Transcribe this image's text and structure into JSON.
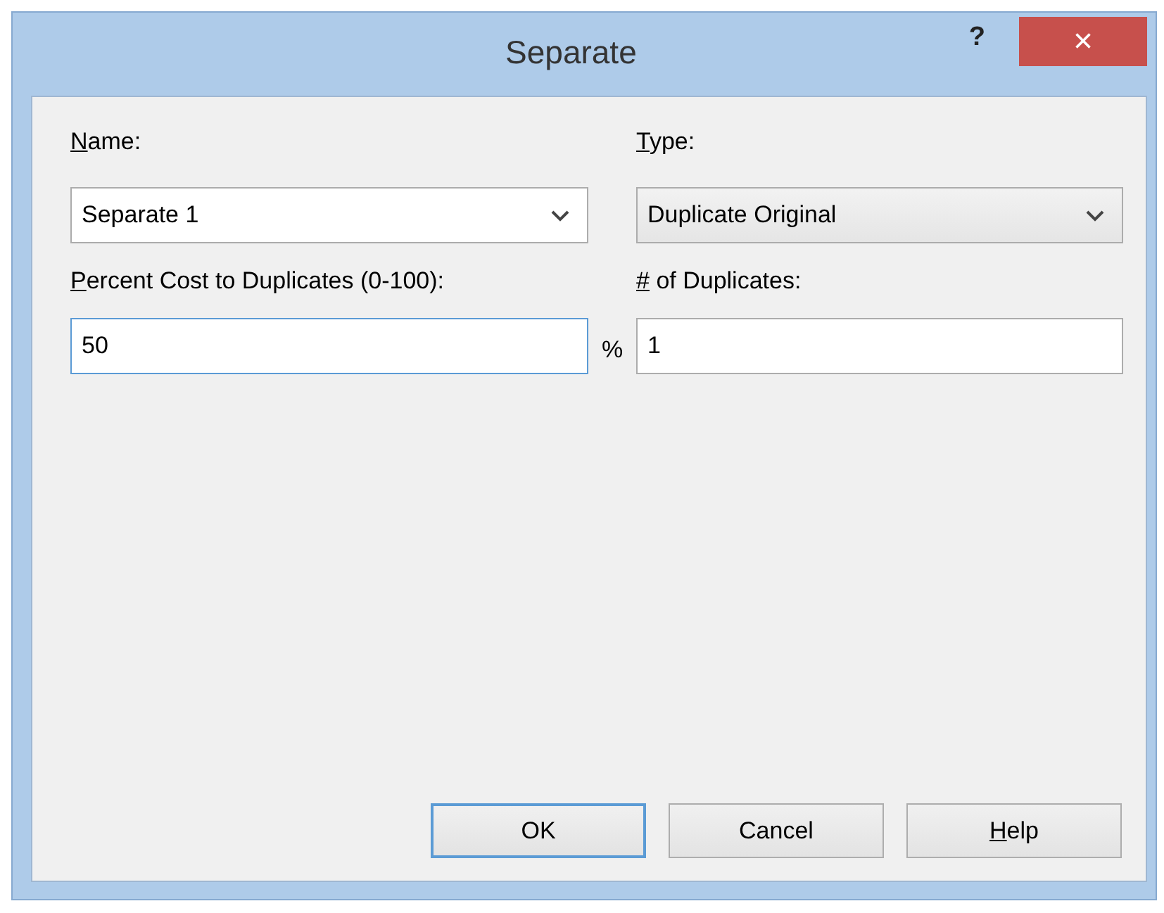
{
  "window": {
    "title": "Separate",
    "help_button": "?",
    "close_button": "×"
  },
  "name": {
    "label": "Name:",
    "first_letter_underlined": true,
    "value": "Separate 1",
    "editable": true
  },
  "type": {
    "label": "Type:",
    "first_letter_underlined": true,
    "value": "Duplicate Original",
    "editable": false
  },
  "percent_cost": {
    "label": "Percent Cost to Duplicates (0-100):",
    "first_letter_underlined": true,
    "value": "50",
    "unit": "%",
    "focused": true
  },
  "duplicates": {
    "label": "# of Duplicates:",
    "first_letter_underlined": true,
    "value": "1",
    "focused": false
  },
  "buttons": [
    {
      "label": "OK",
      "first_letter_underlined": false,
      "default": true
    },
    {
      "label": "Cancel",
      "first_letter_underlined": false,
      "default": false
    },
    {
      "label": "Help",
      "first_letter_underlined": true,
      "default": false
    }
  ]
}
